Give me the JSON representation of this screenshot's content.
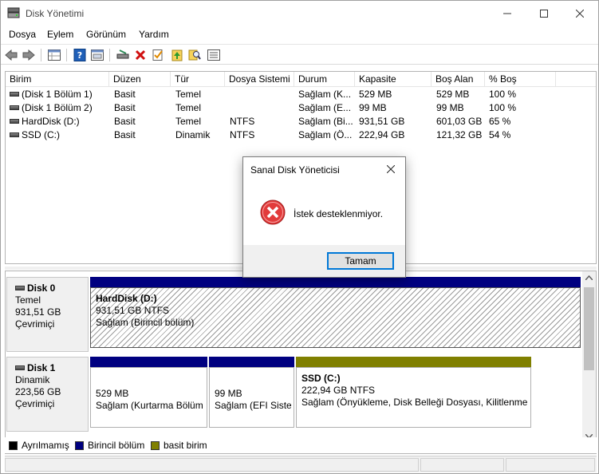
{
  "window": {
    "title": "Disk Yönetimi",
    "controls": [
      "minimize-icon",
      "maximize-icon",
      "close-icon"
    ]
  },
  "menu": [
    "Dosya",
    "Eylem",
    "Görünüm",
    "Yardım"
  ],
  "toolbar": {
    "icons": [
      "back-arrow-icon",
      "forward-arrow-icon",
      "properties-grid-icon",
      "help-icon",
      "show-pane-icon",
      "connect-disk-icon",
      "delete-icon",
      "check-icon",
      "import-icon",
      "search-icon",
      "list-icon"
    ]
  },
  "volume_table": {
    "columns": [
      "Birim",
      "Düzen",
      "Tür",
      "Dosya Sistemi",
      "Durum",
      "Kapasite",
      "Boş Alan",
      "% Boş"
    ],
    "rows": [
      [
        "(Disk 1 Bölüm 1)",
        "Basit",
        "Temel",
        "",
        "Sağlam (K...",
        "529 MB",
        "529 MB",
        "100 %"
      ],
      [
        "(Disk 1 Bölüm 2)",
        "Basit",
        "Temel",
        "",
        "Sağlam (E...",
        "99 MB",
        "99 MB",
        "100 %"
      ],
      [
        "HardDisk (D:)",
        "Basit",
        "Temel",
        "NTFS",
        "Sağlam (Bi...",
        "931,51 GB",
        "601,03 GB",
        "65 %"
      ],
      [
        "SSD (C:)",
        "Basit",
        "Dinamik",
        "NTFS",
        "Sağlam (Ö...",
        "222,94 GB",
        "121,32 GB",
        "54 %"
      ]
    ]
  },
  "disks": [
    {
      "name": "Disk 0",
      "type": "Temel",
      "size": "931,51 GB",
      "status": "Çevrimiçi",
      "partitions": [
        {
          "title": "HardDisk  (D:)",
          "line1": "931,51 GB NTFS",
          "line2": "Sağlam (Birincil bölüm)",
          "bar_color": "#000080"
        }
      ]
    },
    {
      "name": "Disk 1",
      "type": "Dinamik",
      "size": "223,56 GB",
      "status": "Çevrimiçi",
      "partitions": [
        {
          "title": "",
          "line1": "529 MB",
          "line2": "Sağlam (Kurtarma Bölüm",
          "bar_color": "#000080"
        },
        {
          "title": "",
          "line1": "99 MB",
          "line2": "Sağlam (EFI Sister",
          "bar_color": "#000080"
        },
        {
          "title": "SSD  (C:)",
          "line1": "222,94 GB NTFS",
          "line2": "Sağlam (Önyükleme, Disk Belleği Dosyası, Kilitlenme",
          "bar_color": "#808000"
        }
      ]
    }
  ],
  "legend": [
    {
      "label": "Ayrılmamış",
      "color": "#000000"
    },
    {
      "label": "Birincil bölüm",
      "color": "#000080"
    },
    {
      "label": "basit birim",
      "color": "#808000"
    }
  ],
  "dialog": {
    "title": "Sanal Disk Yöneticisi",
    "message": "İstek desteklenmiyor.",
    "ok_label": "Tamam",
    "icon": "error-icon"
  }
}
